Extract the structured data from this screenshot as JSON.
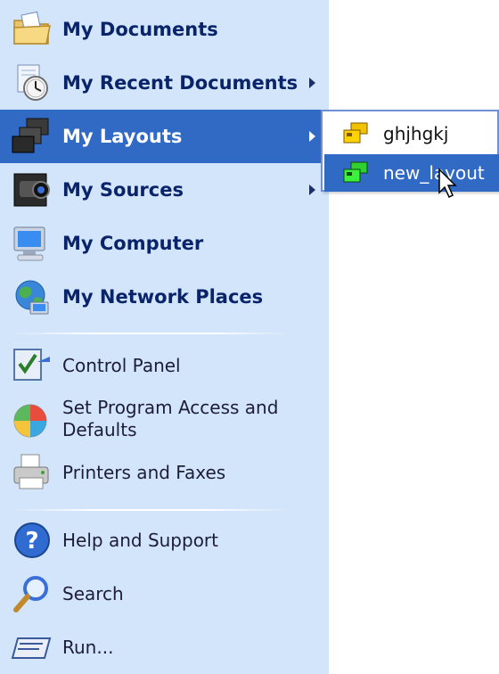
{
  "start_menu": {
    "places": [
      {
        "label": "My Documents",
        "icon": "folder-documents-icon",
        "has_submenu": false
      },
      {
        "label": "My Recent Documents",
        "icon": "recent-documents-icon",
        "has_submenu": true
      },
      {
        "label": "My Layouts",
        "icon": "layouts-icon",
        "has_submenu": true,
        "highlighted": true
      },
      {
        "label": "My Sources",
        "icon": "camera-icon",
        "has_submenu": true
      },
      {
        "label": "My Computer",
        "icon": "computer-icon",
        "has_submenu": false
      },
      {
        "label": "My Network Places",
        "icon": "network-places-icon",
        "has_submenu": false
      }
    ],
    "settings": [
      {
        "label": "Control Panel",
        "icon": "control-panel-icon"
      },
      {
        "label": "Set Program Access and Defaults",
        "icon": "program-access-icon"
      },
      {
        "label": "Printers and Faxes",
        "icon": "printer-icon"
      }
    ],
    "tools": [
      {
        "label": "Help and Support",
        "icon": "help-icon"
      },
      {
        "label": "Search",
        "icon": "search-icon"
      },
      {
        "label": "Run...",
        "icon": "run-icon"
      }
    ]
  },
  "layouts_submenu": {
    "items": [
      {
        "label": "ghjhgkj",
        "icon": "layout-yellow-icon",
        "highlighted": false
      },
      {
        "label": "new_layout",
        "icon": "layout-green-icon",
        "highlighted": true
      }
    ]
  },
  "colors": {
    "menu_background": "#d3e5fa",
    "highlight": "#316ac5",
    "text": "#0a246a"
  }
}
